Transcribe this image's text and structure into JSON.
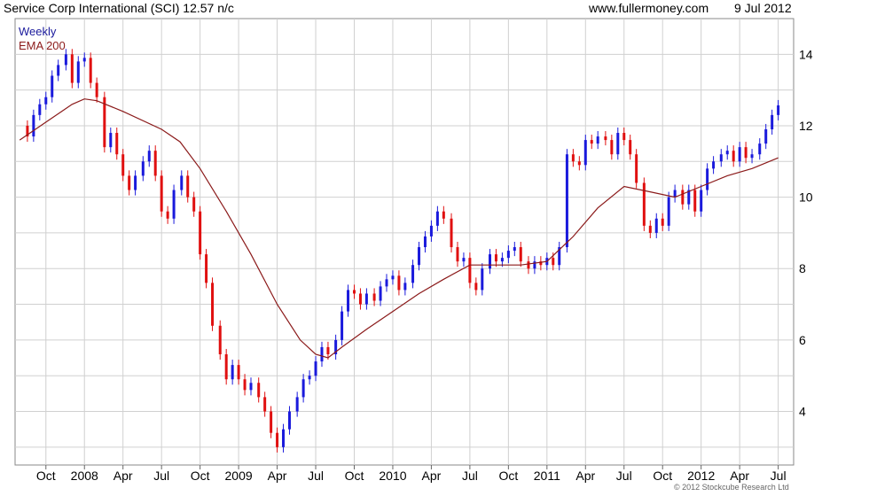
{
  "header": {
    "title": "Service Corp International (SCI) 12.57 n/c",
    "website": "www.fullermoney.com",
    "date": "9 Jul 2012"
  },
  "footer": {
    "copyright": "© 2012 Stockcube Research Ltd"
  },
  "colors": {
    "up": "#1a1adc",
    "down": "#e01010",
    "ema": "#8b1a1a",
    "grid": "#d0d0d0",
    "legend_weekly": "#1a1a9c",
    "legend_ema": "#8b1a1a"
  },
  "chart_data": {
    "type": "line",
    "legend": [
      {
        "name": "Weekly",
        "color": "#1a1a9c"
      },
      {
        "name": "EMA 200",
        "color": "#8b1a1a"
      }
    ],
    "legend_placement": "top-left",
    "grid": true,
    "y_axis": {
      "side": "right",
      "ylim": [
        2.5,
        15
      ],
      "ticks": [
        4,
        6,
        8,
        10,
        12,
        14
      ]
    },
    "x_axis": {
      "range": [
        "2007-08",
        "2012-07"
      ],
      "ticks": [
        {
          "label": "Oct",
          "t": 2007.75
        },
        {
          "label": "2008",
          "t": 2008.0
        },
        {
          "label": "Apr",
          "t": 2008.25
        },
        {
          "label": "Jul",
          "t": 2008.5
        },
        {
          "label": "Oct",
          "t": 2008.75
        },
        {
          "label": "2009",
          "t": 2009.0
        },
        {
          "label": "Apr",
          "t": 2009.25
        },
        {
          "label": "Jul",
          "t": 2009.5
        },
        {
          "label": "Oct",
          "t": 2009.75
        },
        {
          "label": "2010",
          "t": 2010.0
        },
        {
          "label": "Apr",
          "t": 2010.25
        },
        {
          "label": "Jul",
          "t": 2010.5
        },
        {
          "label": "Oct",
          "t": 2010.75
        },
        {
          "label": "2011",
          "t": 2011.0
        },
        {
          "label": "Apr",
          "t": 2011.25
        },
        {
          "label": "Jul",
          "t": 2011.5
        },
        {
          "label": "Oct",
          "t": 2011.75
        },
        {
          "label": "2012",
          "t": 2012.0
        },
        {
          "label": "Apr",
          "t": 2012.25
        },
        {
          "label": "Jul",
          "t": 2012.5
        }
      ]
    },
    "series": [
      {
        "name": "Weekly",
        "note": "weekly close, approximate",
        "points": [
          [
            2007.58,
            12.0
          ],
          [
            2007.63,
            11.7
          ],
          [
            2007.67,
            12.3
          ],
          [
            2007.71,
            12.6
          ],
          [
            2007.75,
            12.8
          ],
          [
            2007.79,
            13.4
          ],
          [
            2007.83,
            13.7
          ],
          [
            2007.88,
            14.0
          ],
          [
            2007.92,
            13.2
          ],
          [
            2007.96,
            13.8
          ],
          [
            2008.0,
            13.9
          ],
          [
            2008.04,
            13.2
          ],
          [
            2008.08,
            12.8
          ],
          [
            2008.13,
            11.4
          ],
          [
            2008.17,
            11.8
          ],
          [
            2008.21,
            11.2
          ],
          [
            2008.25,
            10.6
          ],
          [
            2008.29,
            10.2
          ],
          [
            2008.33,
            10.6
          ],
          [
            2008.38,
            11.0
          ],
          [
            2008.42,
            11.3
          ],
          [
            2008.46,
            10.6
          ],
          [
            2008.5,
            9.6
          ],
          [
            2008.54,
            9.4
          ],
          [
            2008.58,
            10.2
          ],
          [
            2008.63,
            10.6
          ],
          [
            2008.67,
            10.0
          ],
          [
            2008.71,
            9.6
          ],
          [
            2008.75,
            8.4
          ],
          [
            2008.79,
            7.6
          ],
          [
            2008.83,
            6.4
          ],
          [
            2008.88,
            5.6
          ],
          [
            2008.92,
            4.9
          ],
          [
            2008.96,
            5.3
          ],
          [
            2009.0,
            4.9
          ],
          [
            2009.04,
            4.6
          ],
          [
            2009.08,
            4.8
          ],
          [
            2009.13,
            4.4
          ],
          [
            2009.17,
            4.0
          ],
          [
            2009.21,
            3.4
          ],
          [
            2009.25,
            3.0
          ],
          [
            2009.29,
            3.5
          ],
          [
            2009.33,
            4.0
          ],
          [
            2009.38,
            4.4
          ],
          [
            2009.42,
            4.9
          ],
          [
            2009.46,
            5.0
          ],
          [
            2009.5,
            5.4
          ],
          [
            2009.54,
            5.8
          ],
          [
            2009.58,
            5.6
          ],
          [
            2009.63,
            6.0
          ],
          [
            2009.67,
            6.8
          ],
          [
            2009.71,
            7.4
          ],
          [
            2009.75,
            7.3
          ],
          [
            2009.79,
            7.0
          ],
          [
            2009.83,
            7.3
          ],
          [
            2009.88,
            7.1
          ],
          [
            2009.92,
            7.5
          ],
          [
            2009.96,
            7.7
          ],
          [
            2010.0,
            7.8
          ],
          [
            2010.04,
            7.4
          ],
          [
            2010.08,
            7.6
          ],
          [
            2010.13,
            8.1
          ],
          [
            2010.17,
            8.6
          ],
          [
            2010.21,
            8.9
          ],
          [
            2010.25,
            9.2
          ],
          [
            2010.29,
            9.6
          ],
          [
            2010.33,
            9.4
          ],
          [
            2010.38,
            8.6
          ],
          [
            2010.42,
            8.2
          ],
          [
            2010.46,
            8.3
          ],
          [
            2010.5,
            7.6
          ],
          [
            2010.54,
            7.4
          ],
          [
            2010.58,
            8.0
          ],
          [
            2010.63,
            8.4
          ],
          [
            2010.67,
            8.2
          ],
          [
            2010.71,
            8.3
          ],
          [
            2010.75,
            8.5
          ],
          [
            2010.79,
            8.6
          ],
          [
            2010.83,
            8.2
          ],
          [
            2010.88,
            8.0
          ],
          [
            2010.92,
            8.2
          ],
          [
            2010.96,
            8.1
          ],
          [
            2011.0,
            8.3
          ],
          [
            2011.04,
            8.1
          ],
          [
            2011.08,
            8.6
          ],
          [
            2011.13,
            11.2
          ],
          [
            2011.17,
            11.0
          ],
          [
            2011.21,
            10.9
          ],
          [
            2011.25,
            11.6
          ],
          [
            2011.29,
            11.5
          ],
          [
            2011.33,
            11.7
          ],
          [
            2011.38,
            11.6
          ],
          [
            2011.42,
            11.2
          ],
          [
            2011.46,
            11.8
          ],
          [
            2011.5,
            11.6
          ],
          [
            2011.54,
            11.2
          ],
          [
            2011.58,
            10.4
          ],
          [
            2011.63,
            9.2
          ],
          [
            2011.67,
            9.0
          ],
          [
            2011.71,
            9.4
          ],
          [
            2011.75,
            9.2
          ],
          [
            2011.79,
            10.0
          ],
          [
            2011.83,
            10.2
          ],
          [
            2011.88,
            9.8
          ],
          [
            2011.92,
            10.2
          ],
          [
            2011.96,
            9.6
          ],
          [
            2012.0,
            10.2
          ],
          [
            2012.04,
            10.8
          ],
          [
            2012.08,
            11.0
          ],
          [
            2012.13,
            11.2
          ],
          [
            2012.17,
            11.3
          ],
          [
            2012.21,
            11.0
          ],
          [
            2012.25,
            11.4
          ],
          [
            2012.29,
            11.1
          ],
          [
            2012.33,
            11.2
          ],
          [
            2012.38,
            11.5
          ],
          [
            2012.42,
            11.9
          ],
          [
            2012.46,
            12.3
          ],
          [
            2012.5,
            12.57
          ]
        ]
      },
      {
        "name": "EMA 200",
        "points": [
          [
            2007.58,
            11.6
          ],
          [
            2007.75,
            12.1
          ],
          [
            2007.92,
            12.6
          ],
          [
            2008.0,
            12.75
          ],
          [
            2008.08,
            12.7
          ],
          [
            2008.25,
            12.4
          ],
          [
            2008.5,
            11.9
          ],
          [
            2008.62,
            11.55
          ],
          [
            2008.75,
            10.8
          ],
          [
            2008.92,
            9.6
          ],
          [
            2009.08,
            8.4
          ],
          [
            2009.25,
            7.0
          ],
          [
            2009.4,
            6.0
          ],
          [
            2009.5,
            5.6
          ],
          [
            2009.58,
            5.5
          ],
          [
            2009.67,
            5.8
          ],
          [
            2009.83,
            6.3
          ],
          [
            2010.0,
            6.8
          ],
          [
            2010.17,
            7.3
          ],
          [
            2010.33,
            7.7
          ],
          [
            2010.5,
            8.1
          ],
          [
            2010.67,
            8.1
          ],
          [
            2010.83,
            8.1
          ],
          [
            2011.0,
            8.2
          ],
          [
            2011.17,
            8.9
          ],
          [
            2011.33,
            9.7
          ],
          [
            2011.5,
            10.3
          ],
          [
            2011.67,
            10.15
          ],
          [
            2011.83,
            10.0
          ],
          [
            2012.0,
            10.3
          ],
          [
            2012.17,
            10.6
          ],
          [
            2012.33,
            10.8
          ],
          [
            2012.5,
            11.1
          ]
        ]
      }
    ]
  }
}
